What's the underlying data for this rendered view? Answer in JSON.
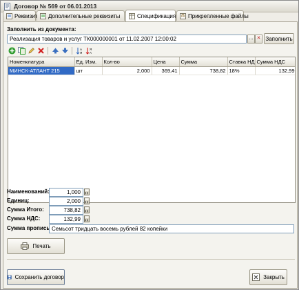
{
  "window": {
    "title": "Договор № 569 от 06.01.2013"
  },
  "tabs": [
    {
      "label": "Реквизиты",
      "icon": "details-icon"
    },
    {
      "label": "Дополнительные реквизиты",
      "icon": "extra-details-icon"
    },
    {
      "label": "Спецификация",
      "icon": "spec-icon"
    },
    {
      "label": "Прикрепленные файлы",
      "icon": "attachment-icon"
    }
  ],
  "fill": {
    "label": "Заполнить из документа:",
    "document_value": "Реализация товаров и услуг ТК000000001 от 11.02.2007 12:00:02",
    "select_glyph": "...",
    "clear_glyph": "✕",
    "button_label": "Заполнить"
  },
  "toolbar": {
    "icons": [
      "add-icon",
      "copy-icon",
      "edit-icon",
      "delete-icon",
      "move-up-icon",
      "move-down-icon",
      "sort-asc-icon",
      "sort-desc-icon"
    ]
  },
  "table": {
    "columns": [
      "Номенклатура",
      "Ед. Изм.",
      "Кол-во",
      "Цена",
      "Сумма",
      "Ставка НДС",
      "Сумма НДС"
    ],
    "rows": [
      {
        "item": "МИНСК-АТЛАНТ 215",
        "unit": "шт",
        "qty": "2,000",
        "price": "369,41",
        "sum": "738,82",
        "vat_rate": "18%",
        "vat_sum": "132,99"
      }
    ]
  },
  "totals": {
    "items_label": "Наименований:",
    "items_value": "1,000",
    "units_label": "Единиц:",
    "units_value": "2,000",
    "total_label": "Сумма Итого:",
    "total_value": "738,82",
    "vat_label": "Сумма НДС:",
    "vat_value": "132,99"
  },
  "words": {
    "label": "Сумма прописью:",
    "value": "Семьсот тридцать восемь рублей 82 копейки"
  },
  "buttons": {
    "print": "Печать",
    "save": "Сохранить договор",
    "close": "Закрыть"
  },
  "colors": {
    "selection": "#316ac5",
    "accent_blue": "#3a6fc0",
    "green": "#2e9b2e",
    "red": "#d02020"
  }
}
